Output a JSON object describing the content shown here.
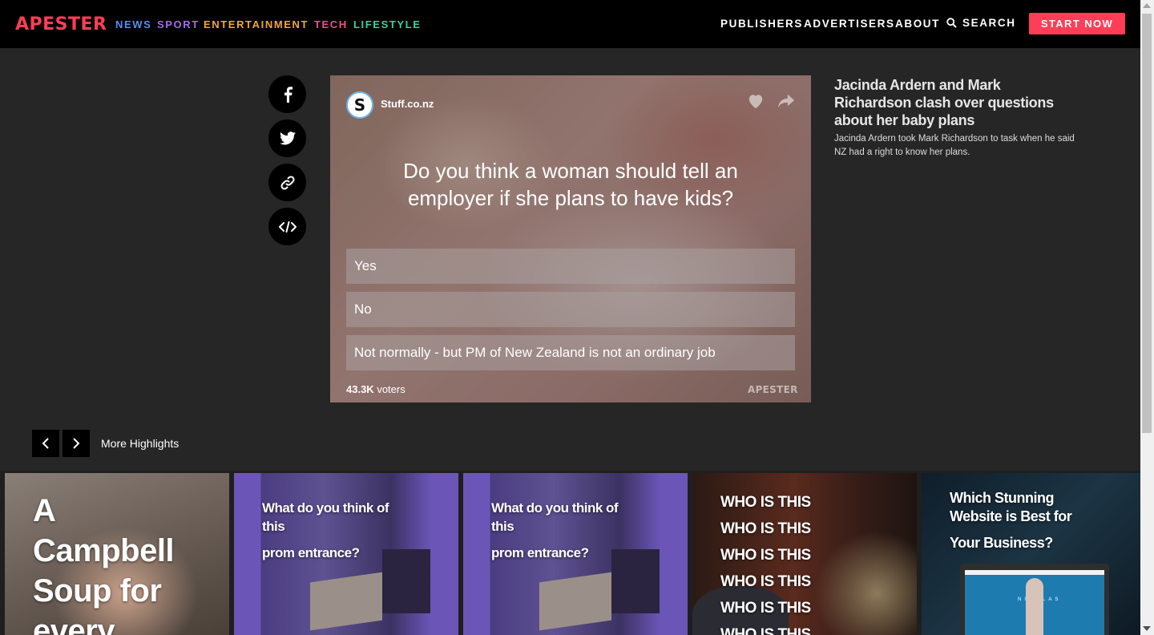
{
  "nav": {
    "logo": "APESTER",
    "categories": [
      {
        "label": "NEWS",
        "color": "#5b8def"
      },
      {
        "label": "SPORT",
        "color": "#a46be8"
      },
      {
        "label": "ENTERTAINMENT",
        "color": "#f0a830"
      },
      {
        "label": "TECH",
        "color": "#ef4f8a"
      },
      {
        "label": "LIFESTYLE",
        "color": "#3fcf9e"
      }
    ],
    "links": [
      "PUBLISHERS",
      "ADVERTISERS",
      "ABOUT"
    ],
    "search_label": "SEARCH",
    "cta_label": "START NOW"
  },
  "share": {
    "icons": [
      "facebook-icon",
      "twitter-icon",
      "link-icon",
      "embed-code-icon"
    ]
  },
  "poll": {
    "source_initial": "S",
    "source_name": "Stuff.co.nz",
    "question": "Do you think a woman should tell an employer if she plans to have kids?",
    "options": [
      "Yes",
      "No",
      "Not normally - but PM of New Zealand is not an ordinary job"
    ],
    "voters_count": "43.3K",
    "voters_label": "voters",
    "brand": "APESTER"
  },
  "article": {
    "title": "Jacinda Ardern and Mark Richardson clash over questions about her baby plans",
    "description": "Jacinda Ardern took Mark Richardson to task when he said NZ had a right to know her plans."
  },
  "highlights": {
    "label": "More Highlights"
  },
  "tiles": [
    {
      "lines": [
        "A",
        "Campbell",
        "Soup for",
        "every"
      ]
    },
    {
      "lines": [
        "What do you think of",
        "this",
        "prom entrance?"
      ]
    },
    {
      "lines": [
        "What do you think of",
        "this",
        "prom entrance?"
      ]
    },
    {
      "lines": [
        "WHO IS THIS",
        "WHO IS THIS",
        "WHO IS THIS",
        "WHO IS THIS",
        "WHO IS THIS",
        "WHO IS THIS"
      ]
    },
    {
      "lines": [
        "Which Stunning",
        "Website is Best for",
        "Your Business?"
      ],
      "mockup_text": "NICOLAS"
    }
  ],
  "colors": {
    "brand_red": "#ff3d56",
    "topbar": "#000000",
    "page_bg": "#262626"
  }
}
